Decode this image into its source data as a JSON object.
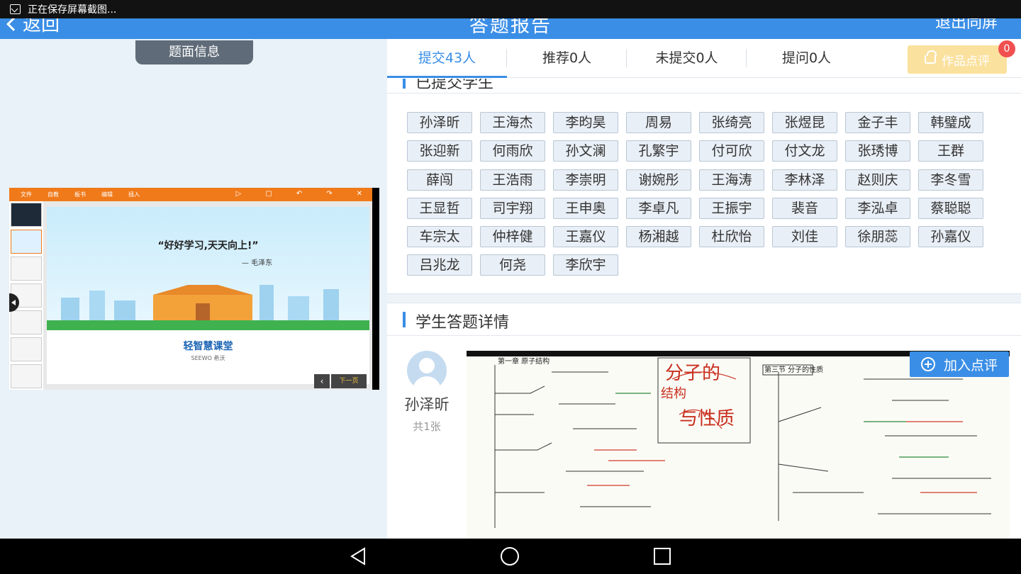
{
  "statusbar": {
    "text": "正在保存屏幕截图..."
  },
  "header": {
    "back_label": "返回",
    "title": "答题报告",
    "exit_label": "退出同屏"
  },
  "left": {
    "tag_label": "题面信息",
    "ppt": {
      "menu": [
        "文件",
        "自教",
        "板书",
        "编辑",
        "插入"
      ],
      "quote": "“好好学习,天天向上!”",
      "author": "— 毛泽东",
      "brand": "轻智慧课堂",
      "brand_sub": "SEEWO 希沃",
      "next_label": "下一页"
    }
  },
  "tabs": [
    {
      "label": "提交43人",
      "active": true
    },
    {
      "label": "推荐0人",
      "active": false
    },
    {
      "label": "未提交0人",
      "active": false
    },
    {
      "label": "提问0人",
      "active": false
    }
  ],
  "review_button": {
    "label": "作品点评",
    "badge": "0"
  },
  "submitted_section": {
    "title": "已提交学生"
  },
  "students": [
    "孙泽昕",
    "王海杰",
    "李昀昊",
    "周易",
    "张绮亮",
    "张煜昆",
    "金子丰",
    "韩璧成",
    "张迎新",
    "何雨欣",
    "孙文澜",
    "孔繁宇",
    "付可欣",
    "付文龙",
    "张琇博",
    "王群",
    "薛闯",
    "王浩雨",
    "李崇明",
    "谢婉彤",
    "王海涛",
    "李林泽",
    "赵则庆",
    "李冬雪",
    "王显哲",
    "司宇翔",
    "王申奥",
    "李卓凡",
    "王振宇",
    "裴音",
    "李泓卓",
    "蔡聪聪",
    "车宗太",
    "仲梓健",
    "王嘉仪",
    "杨湘越",
    "杜欣怡",
    "刘佳",
    "徐朋蕊",
    "孙嘉仪",
    "吕兆龙",
    "何尧",
    "李欣宇"
  ],
  "detail_section": {
    "title": "学生答题详情",
    "student_name": "孙泽昕",
    "count": "共1张",
    "add_review_label": "加入点评",
    "work_texts": {
      "heading": "分子的",
      "heading2": "结构",
      "heading3": "与性质",
      "left_note": "第一章 原子结构",
      "right_note": "第三节 分子的性质"
    }
  }
}
